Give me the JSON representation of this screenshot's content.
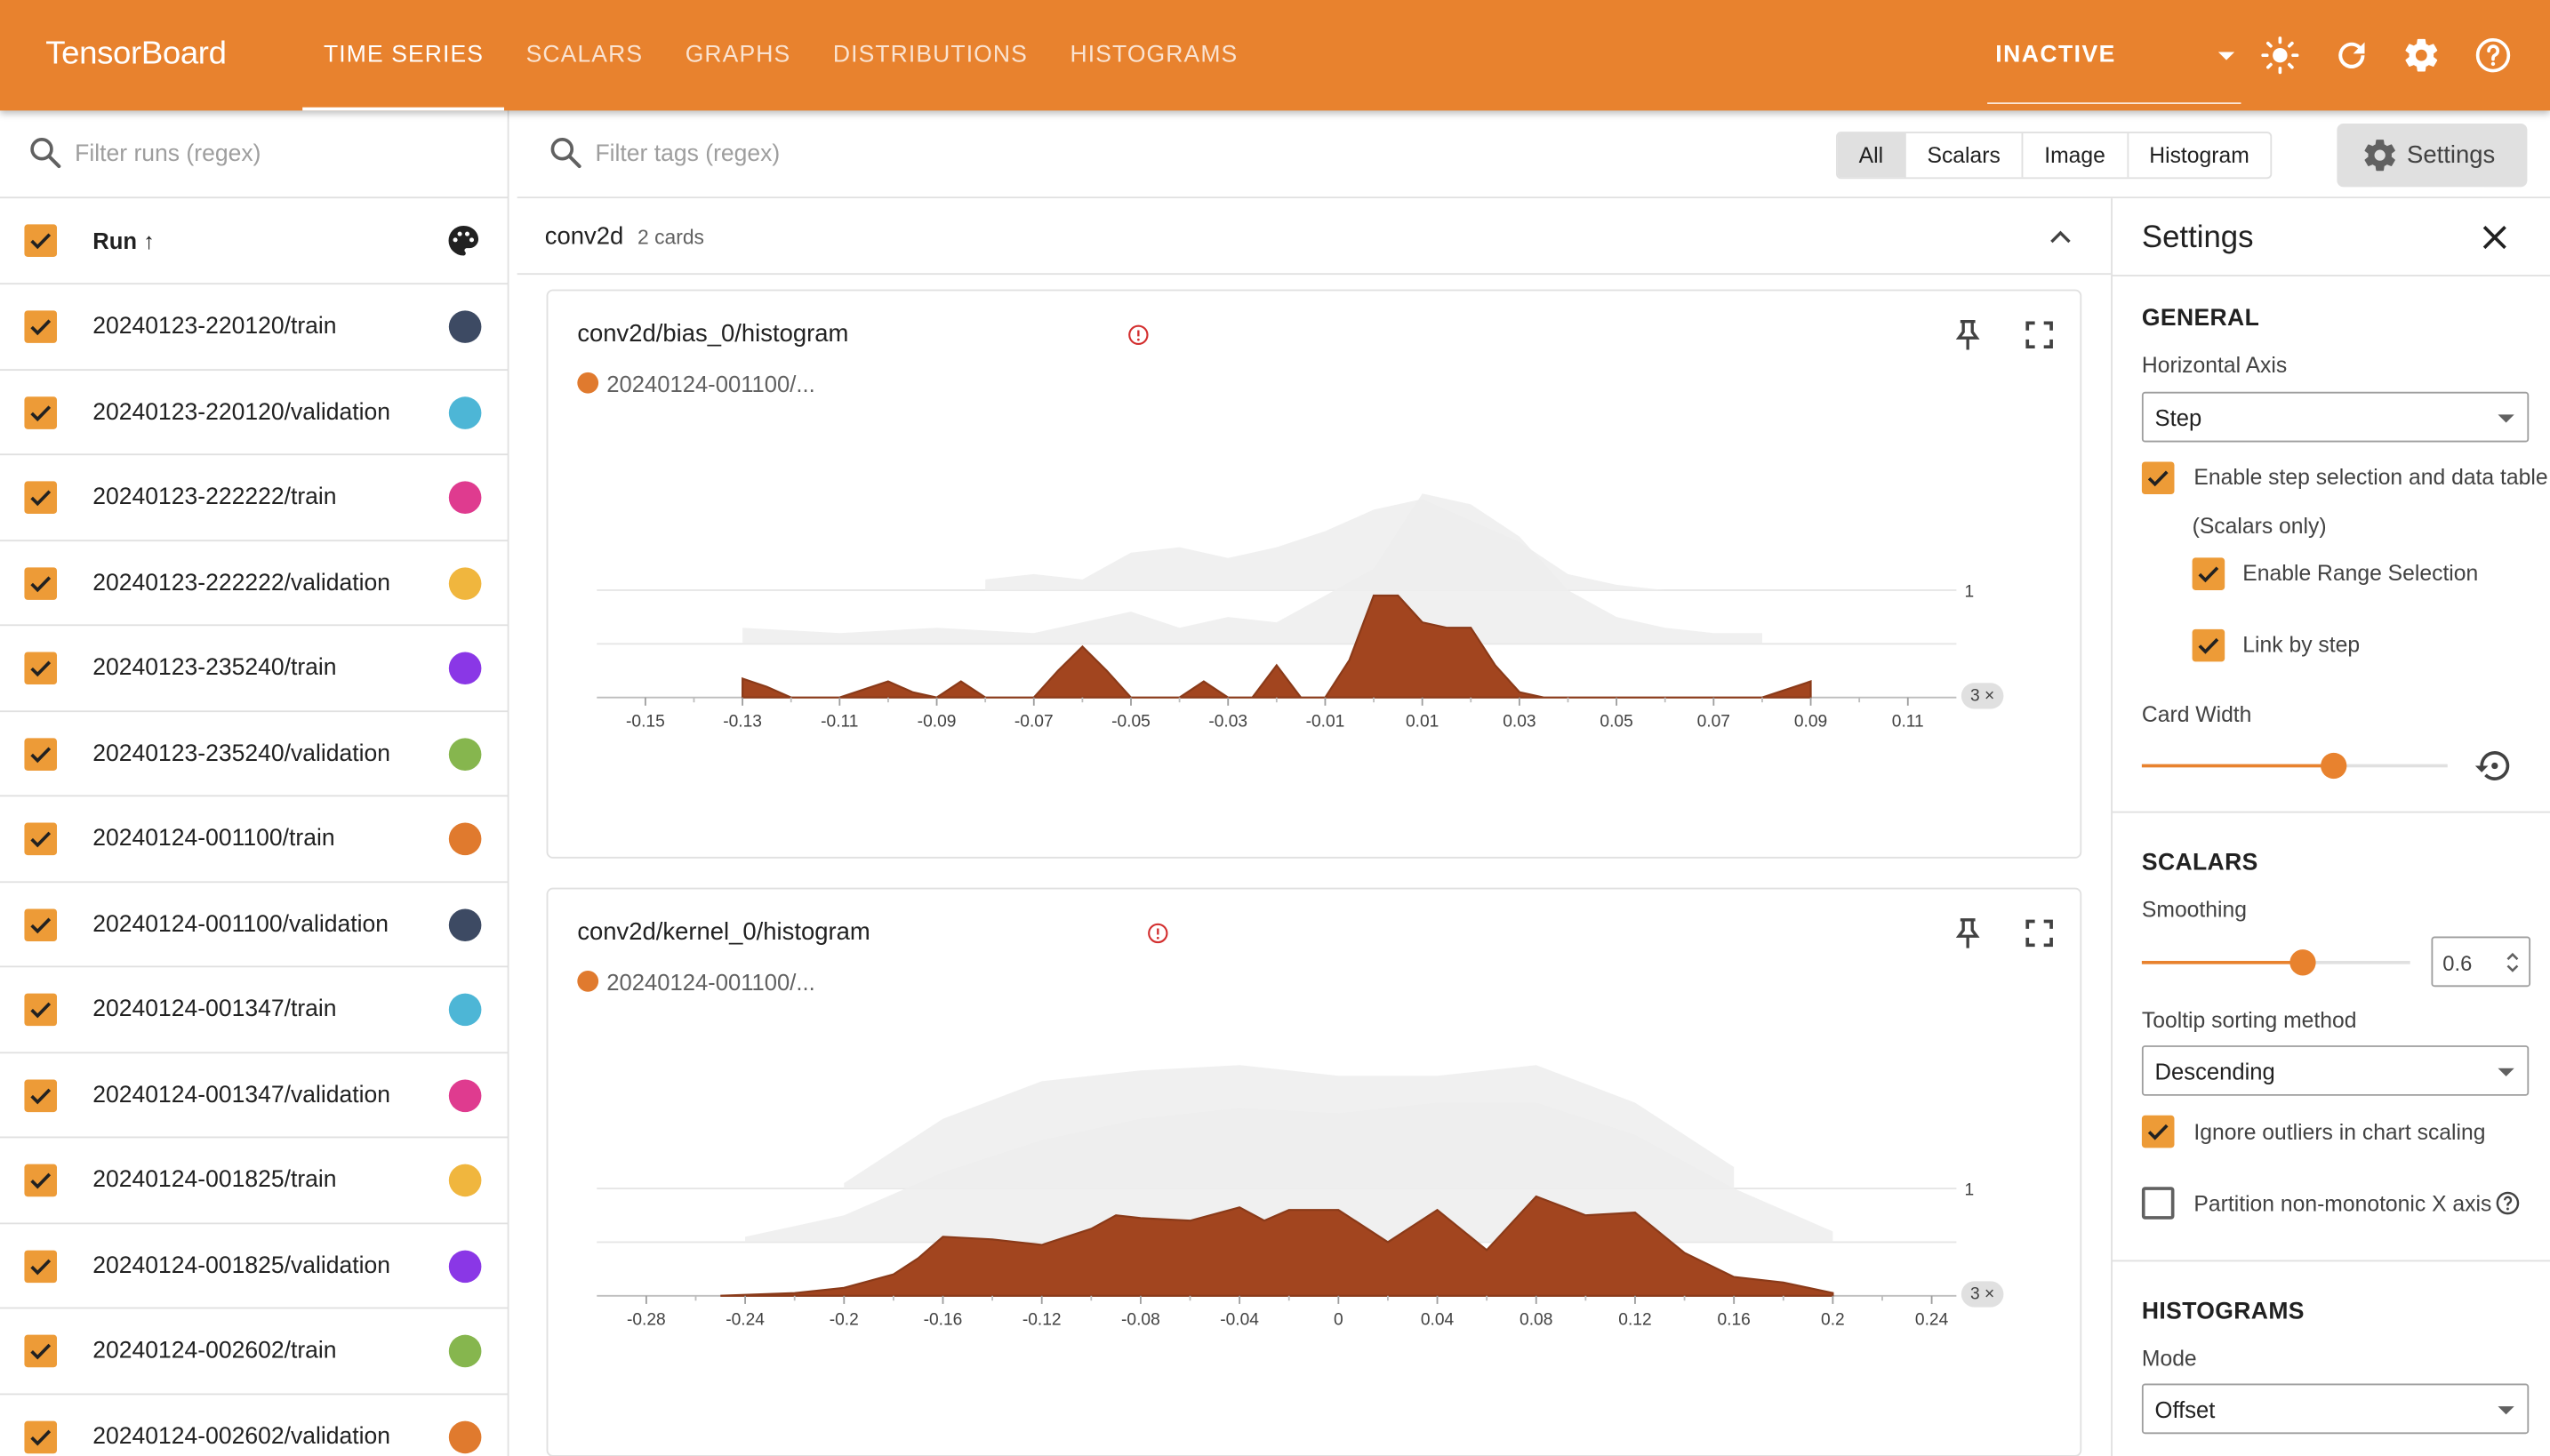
{
  "header": {
    "title": "TensorBoard",
    "tabs": [
      "TIME SERIES",
      "SCALARS",
      "GRAPHS",
      "DISTRIBUTIONS",
      "HISTOGRAMS"
    ],
    "active_tab": "TIME SERIES",
    "run_status": "INACTIVE",
    "accent": "#e8822e"
  },
  "runs": {
    "filter_placeholder": "Filter runs (regex)",
    "column_header": "Run ↑",
    "items": [
      {
        "name": "20240123-220120/train",
        "color": "#3d4a63"
      },
      {
        "name": "20240123-220120/validation",
        "color": "#4db6d6"
      },
      {
        "name": "20240123-222222/train",
        "color": "#df3b8f"
      },
      {
        "name": "20240123-222222/validation",
        "color": "#f0b63e"
      },
      {
        "name": "20240123-235240/train",
        "color": "#8a37e6"
      },
      {
        "name": "20240123-235240/validation",
        "color": "#86b64e"
      },
      {
        "name": "20240124-001100/train",
        "color": "#e07a2e"
      },
      {
        "name": "20240124-001100/validation",
        "color": "#3d4a63"
      },
      {
        "name": "20240124-001347/train",
        "color": "#4db6d6"
      },
      {
        "name": "20240124-001347/validation",
        "color": "#df3b8f"
      },
      {
        "name": "20240124-001825/train",
        "color": "#f0b63e"
      },
      {
        "name": "20240124-001825/validation",
        "color": "#8a37e6"
      },
      {
        "name": "20240124-002602/train",
        "color": "#86b64e"
      },
      {
        "name": "20240124-002602/validation",
        "color": "#e07a2e"
      }
    ]
  },
  "toolbar": {
    "tag_filter_placeholder": "Filter tags (regex)",
    "filters": [
      "All",
      "Scalars",
      "Image",
      "Histogram"
    ],
    "active_filter": "All",
    "settings_label": "Settings"
  },
  "group": {
    "name": "conv2d",
    "count": "2 cards"
  },
  "cards": [
    {
      "title": "conv2d/bias_0/histogram",
      "run_label": "20240124-001100/...",
      "run_color": "#e07a2e",
      "badge": "3 ×",
      "y_tick": "1",
      "x_ticks": [
        "-0.15",
        "-0.13",
        "-0.11",
        "-0.09",
        "-0.07",
        "-0.05",
        "-0.03",
        "-0.01",
        "0.01",
        "0.03",
        "0.05",
        "0.07",
        "0.09",
        "0.11"
      ]
    },
    {
      "title": "conv2d/kernel_0/histogram",
      "run_label": "20240124-001100/...",
      "run_color": "#e07a2e",
      "badge": "3 ×",
      "y_tick": "1",
      "x_ticks": [
        "-0.28",
        "-0.24",
        "-0.2",
        "-0.16",
        "-0.12",
        "-0.08",
        "-0.04",
        "0",
        "0.04",
        "0.08",
        "0.12",
        "0.16",
        "0.2",
        "0.24"
      ]
    }
  ],
  "chart_data": [
    {
      "type": "area",
      "title": "conv2d/bias_0/histogram",
      "mode": "offset",
      "x_range": [
        -0.16,
        0.12
      ],
      "series": [
        {
          "name": "20240124-001100/...",
          "step_offset": 0,
          "x": [
            -0.13,
            -0.125,
            -0.12,
            -0.11,
            -0.1,
            -0.095,
            -0.09,
            -0.085,
            -0.08,
            -0.075,
            -0.07,
            -0.065,
            -0.06,
            -0.055,
            -0.05,
            -0.045,
            -0.04,
            -0.035,
            -0.03,
            -0.025,
            -0.02,
            -0.015,
            -0.01,
            -0.005,
            0,
            0.005,
            0.01,
            0.015,
            0.02,
            0.025,
            0.03,
            0.035,
            0.04,
            0.045,
            0.05,
            0.06,
            0.07,
            0.08,
            0.09
          ],
          "y": [
            0.35,
            0.2,
            0,
            0,
            0.3,
            0.1,
            0,
            0.3,
            0,
            0,
            0,
            0.5,
            0.95,
            0.5,
            0,
            0,
            0,
            0.3,
            0,
            0,
            0.6,
            0,
            0,
            0.7,
            1.9,
            1.9,
            1.4,
            1.3,
            1.3,
            0.6,
            0.1,
            0,
            0,
            0,
            0,
            0,
            0,
            0,
            0.3
          ]
        },
        {
          "step_offset": 1,
          "x": [
            -0.13,
            -0.11,
            -0.09,
            -0.07,
            -0.05,
            -0.04,
            -0.03,
            -0.02,
            -0.01,
            0,
            0.01,
            0.02,
            0.03,
            0.04,
            0.05,
            0.06,
            0.07,
            0.08
          ],
          "y": [
            0.3,
            0.2,
            0.3,
            0.2,
            0.6,
            0.3,
            0.5,
            0.4,
            0.9,
            1.4,
            2.8,
            2.6,
            2.0,
            1.0,
            0.5,
            0.3,
            0.2,
            0.2
          ]
        },
        {
          "step_offset": 2,
          "x": [
            -0.08,
            -0.07,
            -0.06,
            -0.05,
            -0.04,
            -0.03,
            -0.02,
            -0.01,
            0,
            0.01,
            0.02,
            0.03,
            0.04,
            0.05,
            0.06
          ],
          "y": [
            0.2,
            0.3,
            0.2,
            0.7,
            0.8,
            0.6,
            0.8,
            1.1,
            1.5,
            1.7,
            1.3,
            0.9,
            0.3,
            0.1,
            0
          ]
        }
      ]
    },
    {
      "type": "area",
      "title": "conv2d/kernel_0/histogram",
      "mode": "offset",
      "x_range": [
        -0.3,
        0.25
      ],
      "series": [
        {
          "name": "20240124-001100/...",
          "step_offset": 0,
          "x": [
            -0.25,
            -0.22,
            -0.2,
            -0.18,
            -0.17,
            -0.16,
            -0.14,
            -0.12,
            -0.1,
            -0.09,
            -0.08,
            -0.06,
            -0.04,
            -0.03,
            -0.02,
            0,
            0.02,
            0.04,
            0.06,
            0.08,
            0.1,
            0.12,
            0.14,
            0.16,
            0.18,
            0.2
          ],
          "y": [
            0,
            0.05,
            0.15,
            0.4,
            0.7,
            1.1,
            1.05,
            0.95,
            1.25,
            1.5,
            1.45,
            1.4,
            1.65,
            1.4,
            1.6,
            1.6,
            1.0,
            1.6,
            0.85,
            1.85,
            1.5,
            1.55,
            0.8,
            0.35,
            0.25,
            0.05
          ]
        },
        {
          "step_offset": 1,
          "x": [
            -0.24,
            -0.2,
            -0.16,
            -0.12,
            -0.08,
            -0.04,
            0,
            0.04,
            0.08,
            0.12,
            0.16,
            0.2
          ],
          "y": [
            0.1,
            0.5,
            1.3,
            1.9,
            2.3,
            2.5,
            2.4,
            2.6,
            2.6,
            2.0,
            1.0,
            0.2
          ]
        },
        {
          "step_offset": 2,
          "x": [
            -0.2,
            -0.16,
            -0.12,
            -0.08,
            -0.04,
            0,
            0.04,
            0.08,
            0.12,
            0.16
          ],
          "y": [
            0.1,
            1.3,
            2.0,
            2.2,
            2.3,
            2.1,
            2.1,
            2.3,
            1.6,
            0.4
          ]
        }
      ]
    }
  ],
  "settings": {
    "title": "Settings",
    "general": {
      "heading": "GENERAL",
      "horizontal_axis_label": "Horizontal Axis",
      "horizontal_axis_value": "Step",
      "step_selection_label": "Enable step selection and data table",
      "step_selection_note": "(Scalars only)",
      "range_selection_label": "Enable Range Selection",
      "link_by_step_label": "Link by step",
      "card_width_label": "Card Width",
      "card_width_level": 0.63
    },
    "scalars": {
      "heading": "SCALARS",
      "smoothing_label": "Smoothing",
      "smoothing_value": "0.6",
      "smoothing_level": 0.6,
      "tooltip_sort_label": "Tooltip sorting method",
      "tooltip_sort_value": "Descending",
      "ignore_outliers_label": "Ignore outliers in chart scaling",
      "partition_label": "Partition non-monotonic X axis"
    },
    "histograms": {
      "heading": "HISTOGRAMS",
      "mode_label": "Mode",
      "mode_value": "Offset"
    }
  }
}
